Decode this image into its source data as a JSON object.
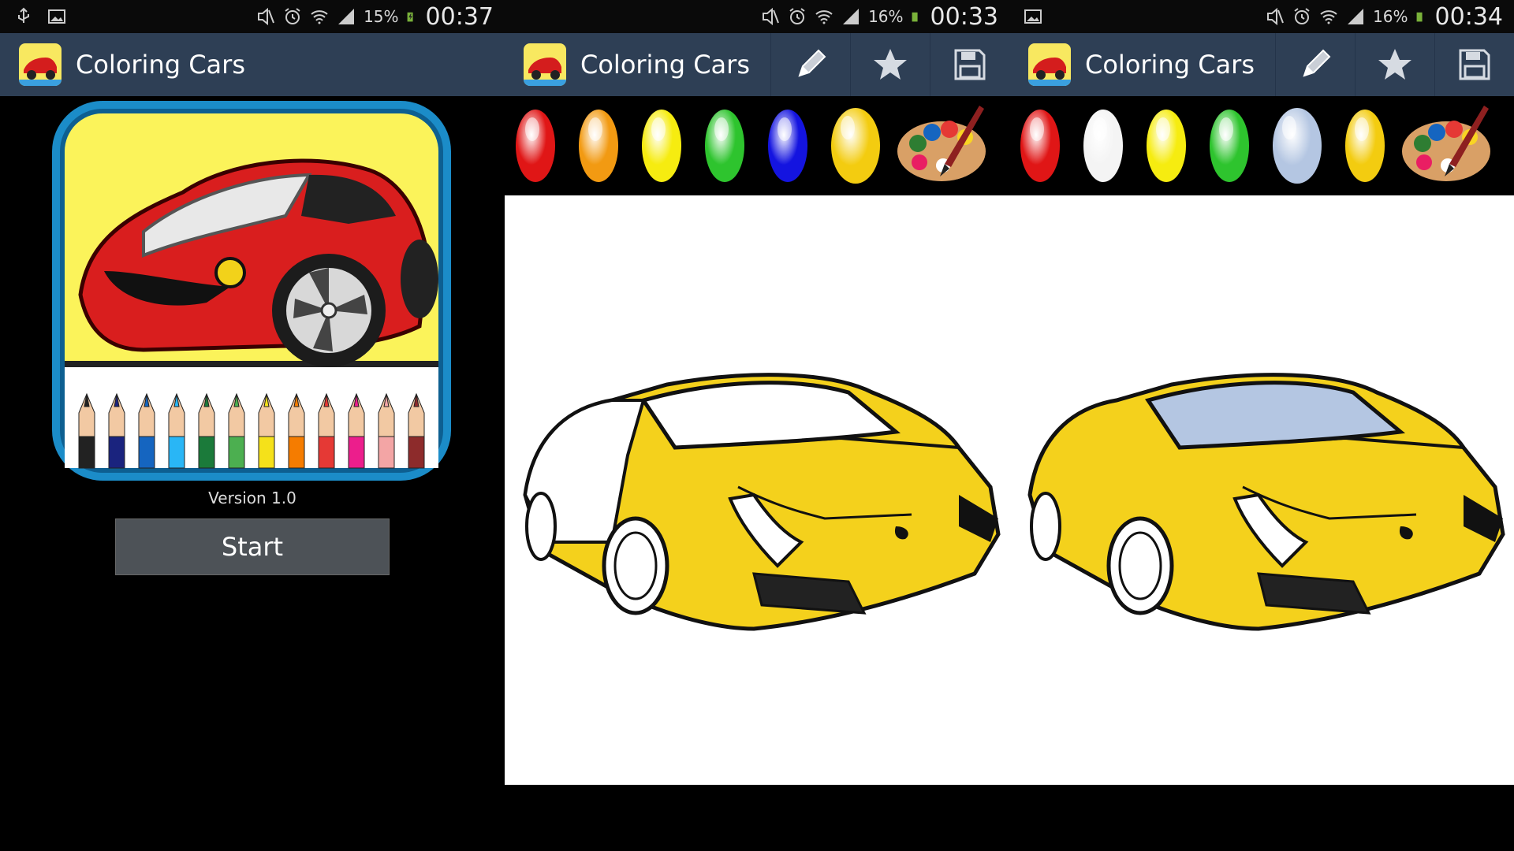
{
  "panels": [
    {
      "status": {
        "battery": "15%",
        "time": "00:37"
      },
      "app_title": "Coloring Cars",
      "version": "Version 1.0",
      "start_label": "Start"
    },
    {
      "status": {
        "battery": "16%",
        "time": "00:33"
      },
      "app_title": "Coloring Cars",
      "palette": [
        "#e01616",
        "#f29a12",
        "#f6ec10",
        "#2ec42e",
        "#1414e0",
        "#f3cc10"
      ],
      "car_body_color": "#f4d11c",
      "car_window_color": "#ffffff"
    },
    {
      "status": {
        "battery": "16%",
        "time": "00:34"
      },
      "app_title": "Coloring Cars",
      "palette": [
        "#e01616",
        "#f4f4f4",
        "#f6ec10",
        "#2ec42e",
        "#b4c6e2",
        "#f3cc10"
      ],
      "car_body_color": "#f4d11c",
      "car_window_color": "#b4c6e2"
    }
  ],
  "icons": [
    "usb-icon",
    "image-icon",
    "mute-icon",
    "alarm-icon",
    "wifi-icon",
    "signal-icon",
    "battery-icon",
    "pencil-icon",
    "star-icon",
    "save-icon",
    "palette-brush-icon"
  ]
}
